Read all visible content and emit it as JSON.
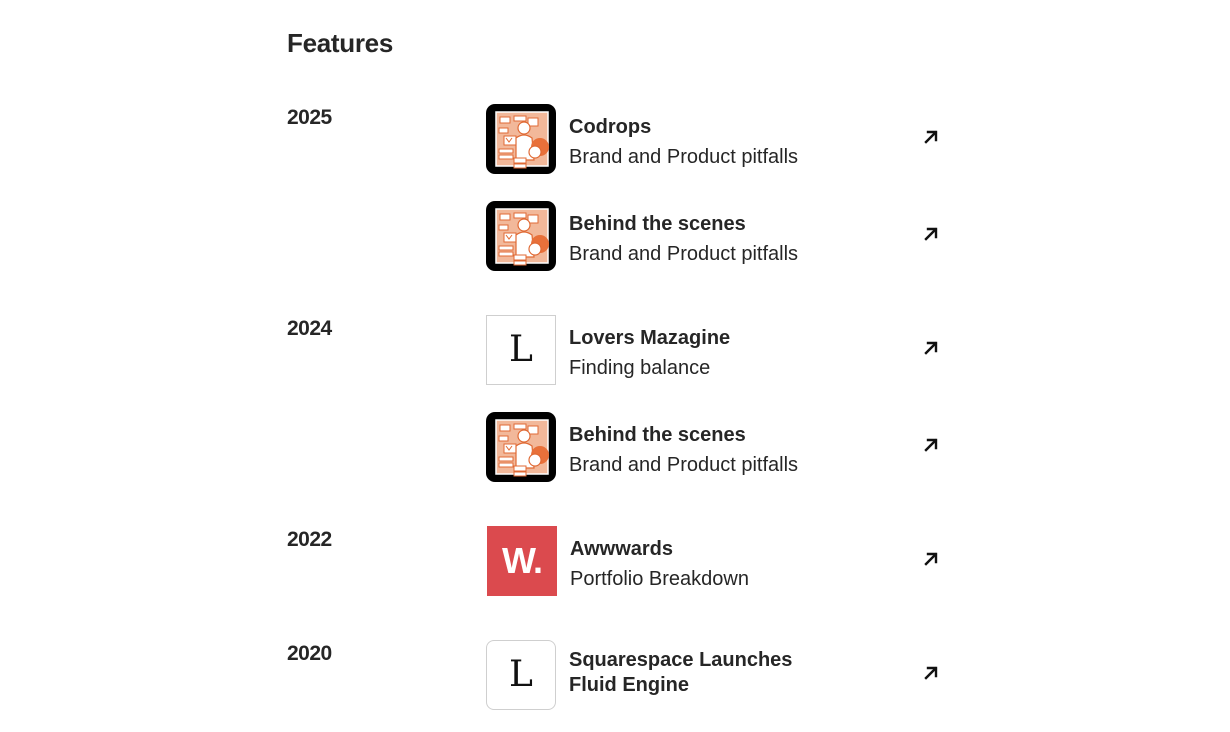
{
  "section_title": "Features",
  "groups": [
    {
      "year": "2025",
      "items": [
        {
          "title": "Codrops",
          "subtitle": "Brand and Product pitfalls",
          "thumb": "illustration-thumb",
          "link_icon": "arrow-up-right-icon"
        },
        {
          "title": "Behind the scenes",
          "subtitle": "Brand and Product pitfalls",
          "thumb": "illustration-thumb",
          "link_icon": "arrow-up-right-icon"
        }
      ]
    },
    {
      "year": "2024",
      "items": [
        {
          "title": "Lovers Mazagine",
          "subtitle": "Finding balance",
          "thumb": "letter-thumb",
          "thumb_text": "L",
          "link_icon": "arrow-up-right-icon"
        },
        {
          "title": "Behind the scenes",
          "subtitle": "Brand and Product pitfalls",
          "thumb": "illustration-thumb",
          "link_icon": "arrow-up-right-icon"
        }
      ]
    },
    {
      "year": "2022",
      "items": [
        {
          "title": "Awwwards",
          "subtitle": "Portfolio Breakdown",
          "thumb": "brand-thumb",
          "thumb_text": "W.",
          "thumb_color": "#db4a4e",
          "link_icon": "arrow-up-right-icon"
        }
      ]
    },
    {
      "year": "2020",
      "items": [
        {
          "title": "Squarespace Launches Fluid Engine",
          "title_line1": "Squarespace Launches",
          "title_line2": "Fluid Engine",
          "thumb": "letter-thumb",
          "thumb_text": "L",
          "link_icon": "arrow-up-right-icon"
        }
      ]
    }
  ],
  "colors": {
    "text": "#262626",
    "illustration_accent": "#e8703a",
    "illustration_fill": "#f2b89a",
    "awwwards_red": "#db4a4e"
  }
}
